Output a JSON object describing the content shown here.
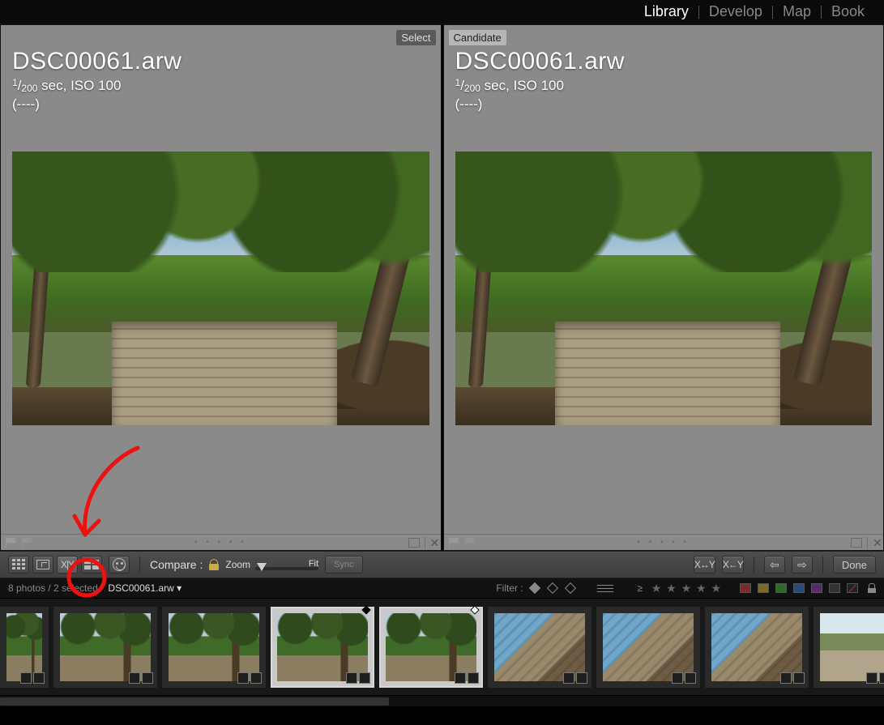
{
  "modules": {
    "items": [
      "Library",
      "Develop",
      "Map",
      "Book"
    ],
    "active": "Library"
  },
  "panes": {
    "select": {
      "tag": "Select",
      "filename": "DSC00061.arw",
      "exposure_html": "¹⁄₂₀₀ sec, ISO 100",
      "lens": "(----)"
    },
    "candidate": {
      "tag": "Candidate",
      "filename": "DSC00061.arw",
      "exposure_html": "¹⁄₂₀₀ sec, ISO 100",
      "lens": "(----)"
    }
  },
  "toolbar": {
    "compare_label": "Compare :",
    "zoom_label": "Zoom",
    "fit_label": "Fit",
    "sync_label": "Sync",
    "swap_label": "X↔Y",
    "promote_label": "X←Y",
    "done_label": "Done"
  },
  "filterbar": {
    "count_text": "8 photos / 2 selected /",
    "current": "DSC00061.arw",
    "filter_label": "Filter :"
  },
  "filmstrip": {
    "thumbs": [
      {
        "kind": "trees",
        "sel": false,
        "first": true
      },
      {
        "kind": "trees",
        "sel": false
      },
      {
        "kind": "trees",
        "sel": false
      },
      {
        "kind": "trees",
        "sel": true,
        "mark": "black"
      },
      {
        "kind": "trees",
        "sel": true,
        "mark": "white"
      },
      {
        "kind": "rocks",
        "sel": false
      },
      {
        "kind": "rocks",
        "sel": false
      },
      {
        "kind": "rocks",
        "sel": false
      },
      {
        "kind": "path",
        "sel": false,
        "narrow": true
      }
    ]
  }
}
